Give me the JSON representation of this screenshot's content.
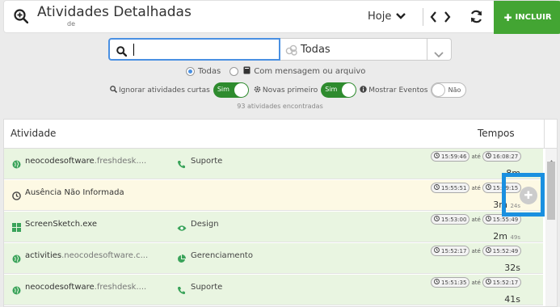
{
  "header": {
    "title": "Atividades Detalhadas",
    "subtitle": "de",
    "period": "Hoje",
    "add_label": "INCLUIR"
  },
  "search": {
    "value": "",
    "placeholder": ""
  },
  "filter": {
    "selected": "Todas"
  },
  "radios": [
    {
      "label": "Todas",
      "checked": true
    },
    {
      "label": "Com mensagem ou arquivo",
      "checked": false
    }
  ],
  "options": {
    "ignore_short_label": "Ignorar atividades curtas",
    "ignore_short_value": "Sim",
    "newest_first_label": "Novas primeiro",
    "newest_first_value": "Sim",
    "show_events_label": "Mostrar Eventos",
    "show_events_value": "Não"
  },
  "found_text": "93 atividades encontradas",
  "table": {
    "col_activity": "Atividade",
    "col_times": "Tempos",
    "until_label": "até",
    "rows": [
      {
        "type": "web",
        "name": "neocodesoftware",
        "domain": ".freshdesk....",
        "category": "Suporte",
        "category_icon": "phone-icon",
        "start": "15:59:46",
        "end": "16:08:27",
        "duration": "8m",
        "duration_small": ""
      },
      {
        "type": "missing",
        "name": "Ausência Não Informada",
        "domain": "",
        "category": "",
        "category_icon": "",
        "start": "15:55:51",
        "end": "15:59:15",
        "duration": "3m",
        "duration_small": "24s"
      },
      {
        "type": "app",
        "name": "ScreenSketch.exe",
        "domain": "",
        "category": "Design",
        "category_icon": "eye-icon",
        "start": "15:53:00",
        "end": "15:55:49",
        "duration": "2m",
        "duration_small": "49s"
      },
      {
        "type": "web",
        "name": "activities",
        "domain": ".neocodesoftware.c...",
        "category": "Gerenciamento",
        "category_icon": "pie-chart-icon",
        "start": "15:52:17",
        "end": "15:52:49",
        "duration": "32s",
        "duration_small": ""
      },
      {
        "type": "web",
        "name": "neocodesoftware",
        "domain": ".freshdesk....",
        "category": "Suporte",
        "category_icon": "phone-icon",
        "start": "15:51:35",
        "end": "15:52:17",
        "duration": "41s",
        "duration_small": ""
      }
    ]
  }
}
